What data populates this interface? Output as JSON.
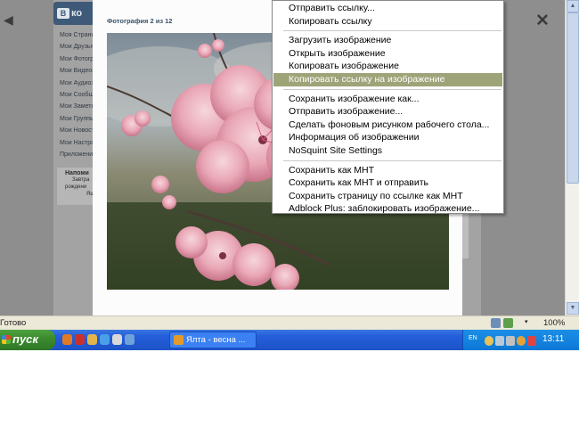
{
  "vk": {
    "logo_text": "ко",
    "logo_letter": "В",
    "menu": [
      "Моя Страница",
      "Мои Друзья",
      "Мои Фотографии",
      "Мои Видеозаписи",
      "Мои Аудиозаписи",
      "Мои Сообщения",
      "Мои Заметки",
      "Мои Группы",
      "Мои Новости",
      "Мои Настройки"
    ],
    "apps_label": "Приложения",
    "reminder": {
      "title": "Напоми",
      "line1": "Завтра",
      "line2": "рождени",
      "line3": "Яш"
    }
  },
  "viewer": {
    "title": "Фотография 2 из 12",
    "prev_icon": "◀",
    "close_icon": "✕"
  },
  "context_menu": {
    "items": [
      {
        "label": "Отправить ссылку..."
      },
      {
        "label": "Копировать ссылку"
      },
      {
        "separator": true
      },
      {
        "label": "Загрузить изображение"
      },
      {
        "label": "Открыть изображение"
      },
      {
        "label": "Копировать изображение"
      },
      {
        "label": "Копировать ссылку на изображение",
        "highlighted": true
      },
      {
        "separator": true
      },
      {
        "label": "Сохранить изображение как..."
      },
      {
        "label": "Отправить изображение..."
      },
      {
        "label": "Сделать фоновым рисунком рабочего стола..."
      },
      {
        "label": "Информация об изображении"
      },
      {
        "label": "NoSquint Site Settings"
      },
      {
        "separator": true
      },
      {
        "label": "Сохранить как MHT"
      },
      {
        "label": "Сохранить как MHT и отправить"
      },
      {
        "label": "Сохранить страницу по ссылке как MHT"
      },
      {
        "label": "Adblock Plus: заблокировать изображение..."
      }
    ],
    "highlight_color": "#9ea378"
  },
  "statusbar": {
    "text": "Готово",
    "zoom": "100%",
    "zoom_arrow": "▾"
  },
  "taskbar": {
    "start_label": "пуск",
    "task_label": "Ялта - весна ...",
    "lang": "EN",
    "clock": "13:11"
  },
  "scrollbar": {
    "up": "▲",
    "down": "▼"
  }
}
